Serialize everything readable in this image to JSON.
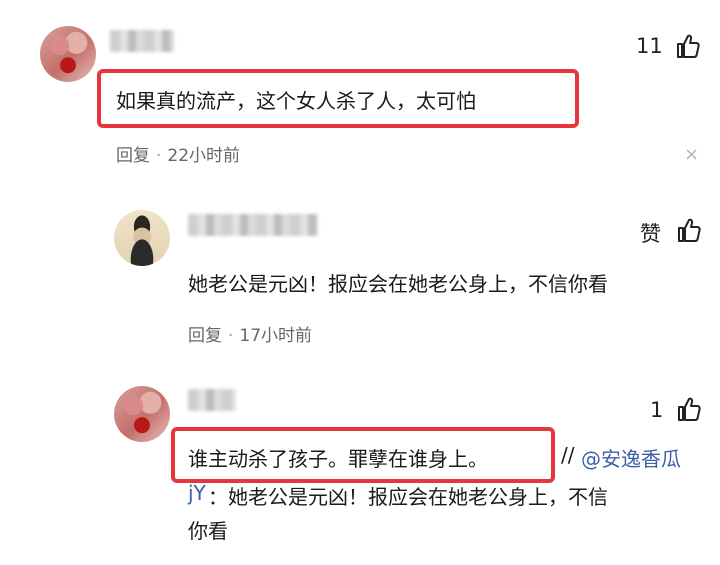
{
  "comments": [
    {
      "likes": "11",
      "text": "如果真的流产，这个女人杀了人，太可怕",
      "reply_label": "回复",
      "separator": "·",
      "time": "22小时前",
      "close_glyph": "×"
    },
    {
      "likes": "赞",
      "text": "她老公是元凶！报应会在她老公身上，不信你看",
      "reply_label": "回复",
      "separator": "·",
      "time": "17小时前"
    },
    {
      "likes": "1",
      "text_highlighted": "谁主动杀了孩子。罪孽在谁身上。",
      "text_slashes": "//",
      "mention": "@安逸香瓜jY",
      "mention_line1": "@安逸香瓜",
      "mention_line2": "jY",
      "text_rest_line2": "：她老公是元凶！报应会在她老公身上，不信",
      "text_rest_line3": "你看"
    }
  ],
  "colors": {
    "highlight": "#e8343d",
    "mention": "#3b5fa8",
    "meta": "#666666"
  }
}
